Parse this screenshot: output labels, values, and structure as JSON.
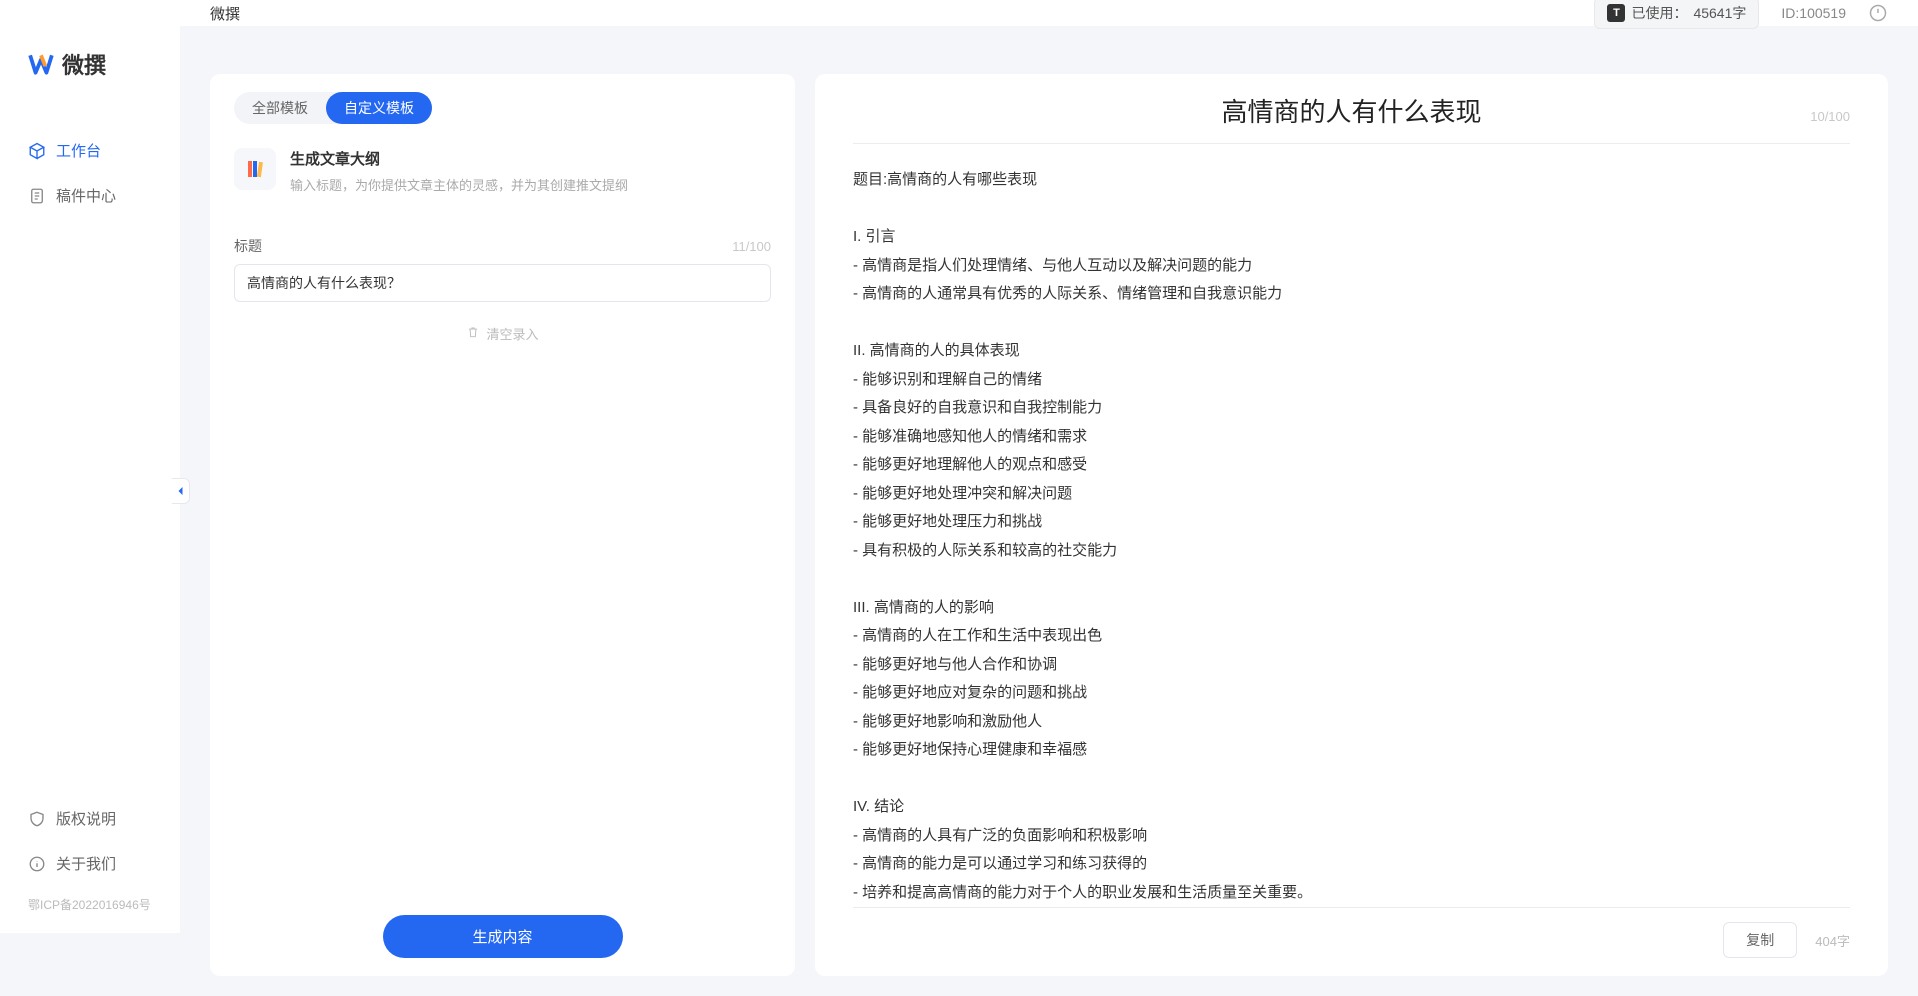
{
  "brand": {
    "name": "微撰"
  },
  "sidebar": {
    "nav": [
      {
        "label": "工作台",
        "icon": "cube-icon",
        "active": true
      },
      {
        "label": "稿件中心",
        "icon": "doc-icon",
        "active": false
      }
    ],
    "bottom": [
      {
        "label": "版权说明",
        "icon": "shield-icon"
      },
      {
        "label": "关于我们",
        "icon": "info-icon"
      }
    ],
    "icp": "鄂ICP备2022016946号"
  },
  "topbar": {
    "page_title": "微撰",
    "usage_label": "已使用：",
    "usage_value": "45641字",
    "user_id": "ID:100519"
  },
  "left": {
    "tabs": [
      {
        "label": "全部模板",
        "active": false
      },
      {
        "label": "自定义模板",
        "active": true
      }
    ],
    "template": {
      "title": "生成文章大纲",
      "desc": "输入标题，为你提供文章主体的灵感，并为其创建推文提纲"
    },
    "field": {
      "label": "标题",
      "count": "11/100",
      "value": "高情商的人有什么表现？"
    },
    "clear_label": "清空录入",
    "generate_label": "生成内容"
  },
  "right": {
    "title": "高情商的人有什么表现",
    "title_count": "10/100",
    "body": "题目:高情商的人有哪些表现\n\nI. 引言\n- 高情商是指人们处理情绪、与他人互动以及解决问题的能力\n- 高情商的人通常具有优秀的人际关系、情绪管理和自我意识能力\n\nII. 高情商的人的具体表现\n- 能够识别和理解自己的情绪\n- 具备良好的自我意识和自我控制能力\n- 能够准确地感知他人的情绪和需求\n- 能够更好地理解他人的观点和感受\n- 能够更好地处理冲突和解决问题\n- 能够更好地处理压力和挑战\n- 具有积极的人际关系和较高的社交能力\n\nIII. 高情商的人的影响\n- 高情商的人在工作和生活中表现出色\n- 能够更好地与他人合作和协调\n- 能够更好地应对复杂的问题和挑战\n- 能够更好地影响和激励他人\n- 能够更好地保持心理健康和幸福感\n\nIV. 结论\n- 高情商的人具有广泛的负面影响和积极影响\n- 高情商的能力是可以通过学习和练习获得的\n- 培养和提高高情商的能力对于个人的职业发展和生活质量至关重要。",
    "copy_label": "复制",
    "word_count": "404字"
  }
}
